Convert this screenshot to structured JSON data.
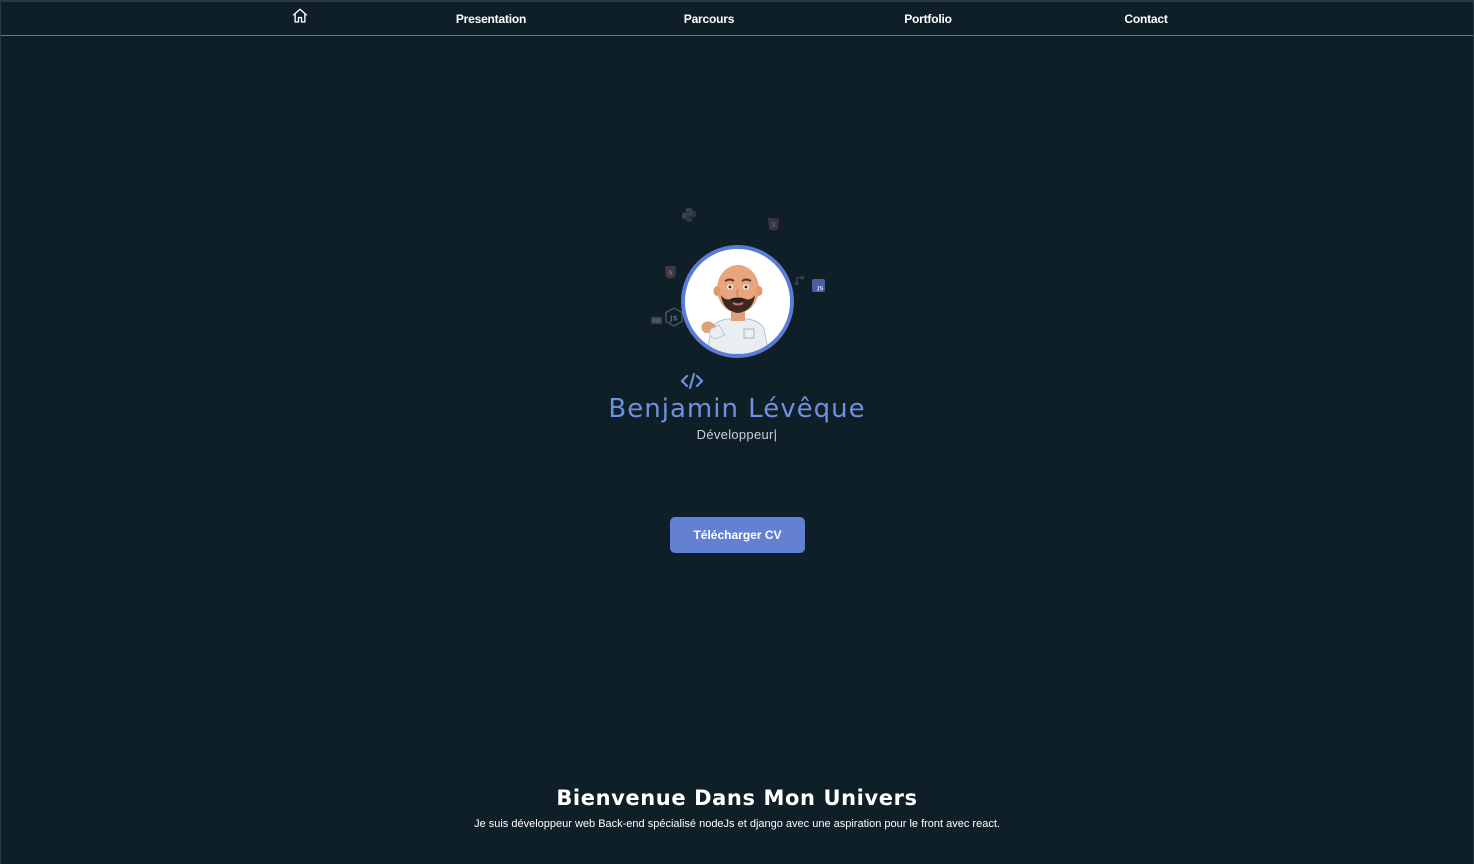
{
  "nav": {
    "home_icon": "home-icon",
    "items": [
      {
        "label": "Presentation"
      },
      {
        "label": "Parcours"
      },
      {
        "label": "Portfolio"
      },
      {
        "label": "Contact"
      }
    ]
  },
  "hero": {
    "name": "Benjamin Lévêque",
    "role": "Développeur",
    "role_cursor": "|",
    "cv_button": "Télécharger CV",
    "floating_icons": [
      "python-icon",
      "css3-icon",
      "html5-icon",
      "git-icon",
      "javascript-icon",
      "nodejs-icon",
      "database-icon",
      "code-icon"
    ]
  },
  "welcome": {
    "title": "Bienvenue Dans Mon Univers",
    "text": "Je suis développeur web Back-end spécialisé nodeJs et django avec une aspiration pour le front avec react."
  },
  "colors": {
    "background": "#0f1f28",
    "accent": "#6380d2",
    "name_color": "#6f8fe0"
  }
}
